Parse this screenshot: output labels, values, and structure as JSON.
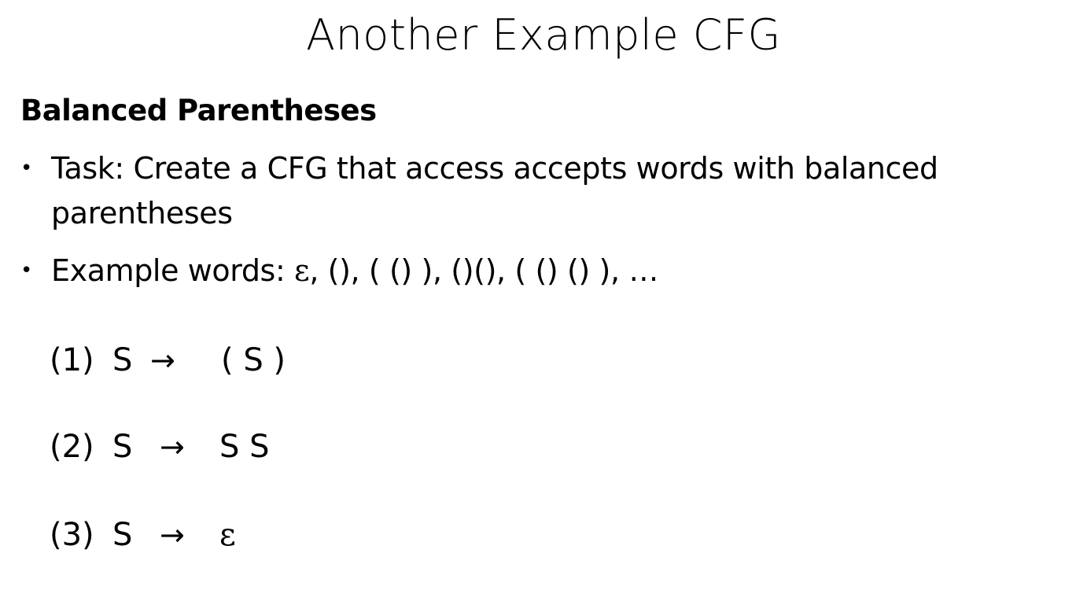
{
  "slide": {
    "title": "Another Example CFG",
    "subtitle": "Balanced Parentheses",
    "bullets": [
      {
        "marker": "•",
        "text": "Task: Create a CFG that access accepts words with balanced parentheses"
      },
      {
        "marker": "•",
        "text_prefix": "Example words: ",
        "epsilon": "ε",
        "text_suffix": ", (), ( () ), ()(), ( () () ), …"
      }
    ],
    "rules": [
      {
        "num": "(1)",
        "lhs": "S",
        "arrow": "→",
        "rhs": "( S )"
      },
      {
        "num": "(2)",
        "lhs": "S",
        "arrow": "→",
        "rhs": "S S"
      },
      {
        "num": "(3)",
        "lhs": "S",
        "arrow": "→",
        "rhs": "ε"
      }
    ]
  }
}
